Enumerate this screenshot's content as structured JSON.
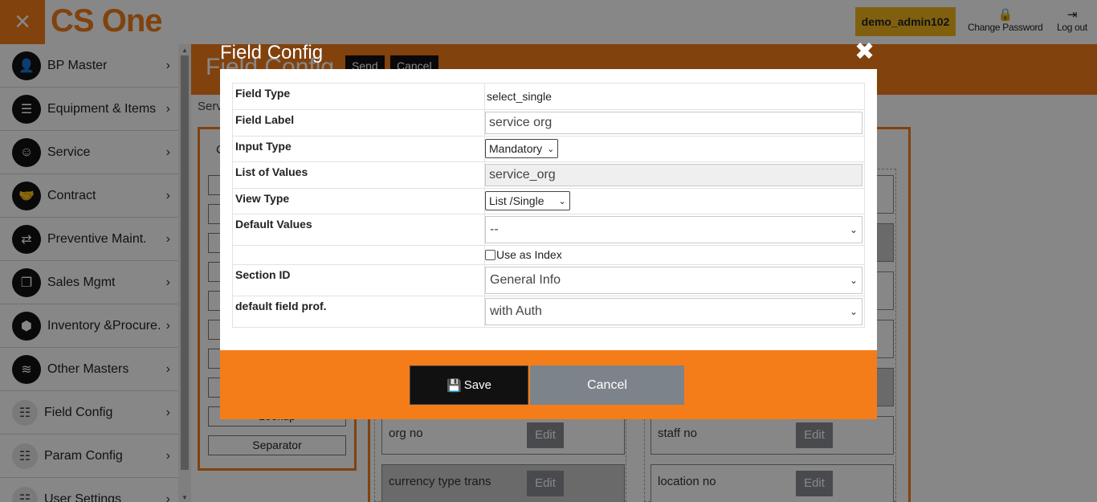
{
  "topbar": {
    "close_icon": "×",
    "logo_cs": "CS",
    "logo_one": "One",
    "username": "demo_admin102",
    "change_password": "Change Password",
    "logout": "Log out"
  },
  "sidebar": {
    "items": [
      {
        "label": "BP Master",
        "icon": "user-icon",
        "glyph": "👤"
      },
      {
        "label": "Equipment & Items",
        "icon": "server-icon",
        "glyph": "☰"
      },
      {
        "label": "Service",
        "icon": "smile-icon",
        "glyph": "☺"
      },
      {
        "label": "Contract",
        "icon": "handshake-icon",
        "glyph": "🤝"
      },
      {
        "label": "Preventive Maint.",
        "icon": "swap-arrows-icon",
        "glyph": "⇄"
      },
      {
        "label": "Sales Mgmt",
        "icon": "copy-icon",
        "glyph": "❐"
      },
      {
        "label": "Inventory &Procure.",
        "icon": "box-icon",
        "glyph": "⬢"
      },
      {
        "label": "Other Masters",
        "icon": "database-icon",
        "glyph": "≋"
      },
      {
        "label": "Field Config",
        "icon": "sliders-icon",
        "glyph": "☷"
      },
      {
        "label": "Param Config",
        "icon": "sliders-icon",
        "glyph": "☷"
      },
      {
        "label": "User Settings",
        "icon": "sliders-icon",
        "glyph": "☷"
      }
    ],
    "chevron": "›"
  },
  "background": {
    "page_title": "Field Config",
    "send_label": "Send",
    "cancel_label": "Cancel",
    "breadcrumb": "Serv",
    "palette_partial": "C",
    "palette_lookup": "Lookup",
    "palette_separator": "Separator",
    "cards": [
      {
        "name": "org no",
        "edit": "Edit"
      },
      {
        "name": "staff no",
        "edit": "Edit"
      },
      {
        "name": "currency type trans",
        "edit": "Edit"
      },
      {
        "name": "location no",
        "edit": "Edit"
      }
    ]
  },
  "modal": {
    "title": "Field Config",
    "close_icon": "✖",
    "fields": {
      "field_type_label": "Field Type",
      "field_type_value": "select_single",
      "field_label_label": "Field Label",
      "field_label_value": "service org",
      "input_type_label": "Input Type",
      "input_type_value": "Mandatory",
      "list_of_values_label": "List of Values",
      "list_of_values_value": "service_org",
      "view_type_label": "View Type",
      "view_type_value": "List /Single",
      "default_values_label": "Default Values",
      "default_values_value": "--",
      "use_as_index_label": "Use as Index",
      "use_as_index_checked": false,
      "section_id_label": "Section ID",
      "section_id_value": "General Info",
      "default_field_prof_label": "default field prof.",
      "default_field_prof_value": "with Auth"
    },
    "save_label": "Save",
    "cancel_label": "Cancel"
  },
  "colors": {
    "accent": "#f47d1a",
    "badge": "#f2b61c",
    "save_bg": "#111111",
    "cancel_bg": "#7d838b"
  }
}
